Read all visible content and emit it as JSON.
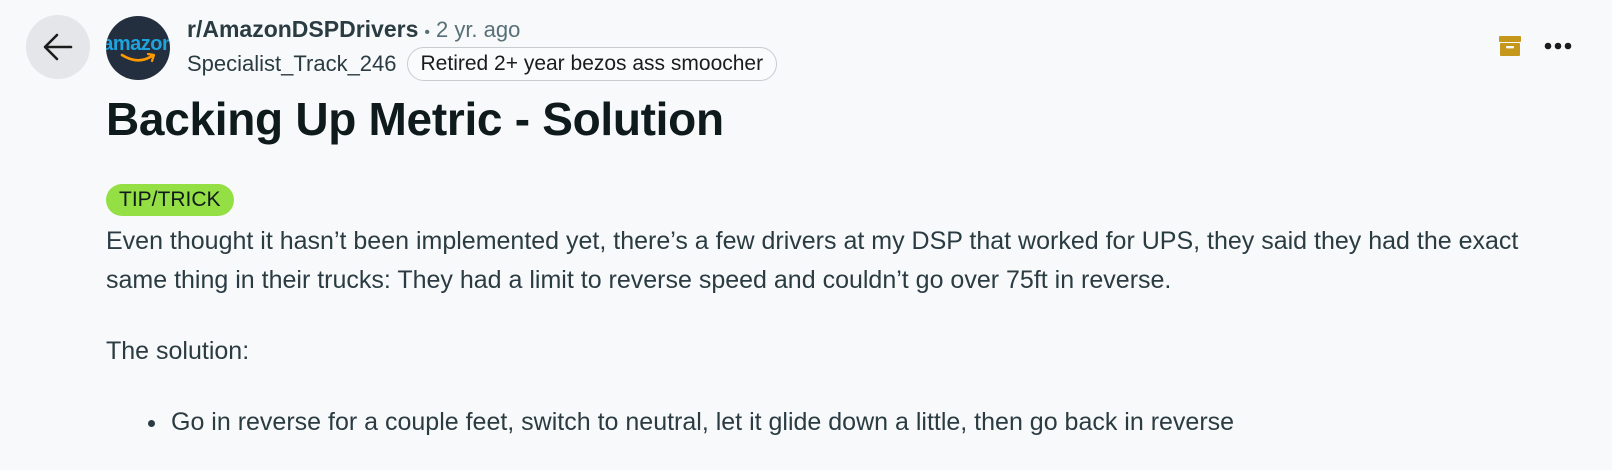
{
  "header": {
    "subreddit": "r/AmazonDSPDrivers",
    "separator": "•",
    "time": "2 yr. ago",
    "username": "Specialist_Track_246",
    "user_flair": "Retired 2+ year bezos ass smoocher",
    "avatar_text": "amazon",
    "icons": [
      "back-arrow-icon",
      "archive-icon",
      "more-options-icon"
    ],
    "colors": {
      "avatar_bg": "#232f3e",
      "archive_icon": "#c5971a",
      "tag": "#94e044"
    }
  },
  "post": {
    "title": "Backing Up Metric - Solution",
    "flair": "TIP/TRICK",
    "paragraph1": "Even thought it hasn’t been implemented yet, there’s a few drivers at my DSP that worked for UPS, they said they had the exact same thing in their trucks: They had a limit to reverse speed and couldn’t go over 75ft in reverse.",
    "paragraph2": "The solution:",
    "bullets": [
      "Go in reverse for a couple feet, switch to neutral, let it glide down a little, then go back in reverse"
    ]
  }
}
